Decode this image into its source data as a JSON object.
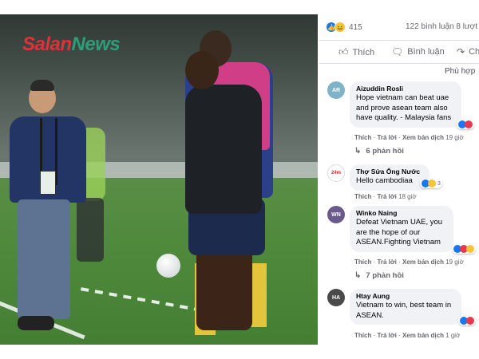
{
  "logo": {
    "part1": "Salan",
    "part2": "ews",
    "n_letter": "N"
  },
  "post": {
    "reaction_count": "415",
    "comment_count": "122 bình luận",
    "share_count": "8 lượt",
    "actions": [
      {
        "label": "Thích",
        "icon": "thumbs-up-icon"
      },
      {
        "label": "Bình luận",
        "icon": "comment-icon"
      },
      {
        "label": "Ch",
        "icon": "share-icon"
      }
    ],
    "sort_label": "Phù hợp"
  },
  "comments": [
    {
      "author": "Aizuddin Rosli",
      "text": "Hope vietnam can beat uae and prove asean team also have quality. - Malaysia fans",
      "meta": [
        "Thích",
        "Trả lời",
        "Xem bản dịch",
        "19 giờ"
      ],
      "replies": "6 phản hồi",
      "reaction_count": "",
      "avatar_color": "#7fb3c8",
      "avatar_label": "AR"
    },
    {
      "author": "Thợ Sửa Ống Nước",
      "text": "Hello cambodiaa",
      "meta": [
        "Thích",
        "Trả lời",
        "18 giờ"
      ],
      "replies": "",
      "reaction_count": "3",
      "avatar_color": "#d8252f",
      "avatar_label": "24m"
    },
    {
      "author": "Winko Naing",
      "text": "Defeat Vietnam UAE, you are the hope of our ASEAN.Fighting Vietnam",
      "meta": [
        "Thích",
        "Trả lời",
        "Xem bản dịch",
        "19 giờ"
      ],
      "replies": "7 phản hồi",
      "reaction_count": "",
      "avatar_color": "#6a5a8c",
      "avatar_label": "WN"
    },
    {
      "author": "Htay Aung",
      "text": "Vietnam to win, best team in ASEAN.",
      "meta": [
        "Thích",
        "Trả lời",
        "Xem bản dịch",
        "1 giờ"
      ],
      "replies": "",
      "reaction_count": "",
      "avatar_color": "#4a4a4a",
      "avatar_label": "HA"
    }
  ],
  "colors": {
    "fb_blue": "#1877f2",
    "bubble_bg": "#f0f2f5",
    "meta_gray": "#65676b",
    "logo_red": "#e0303a",
    "logo_green": "#2f9d7a"
  }
}
